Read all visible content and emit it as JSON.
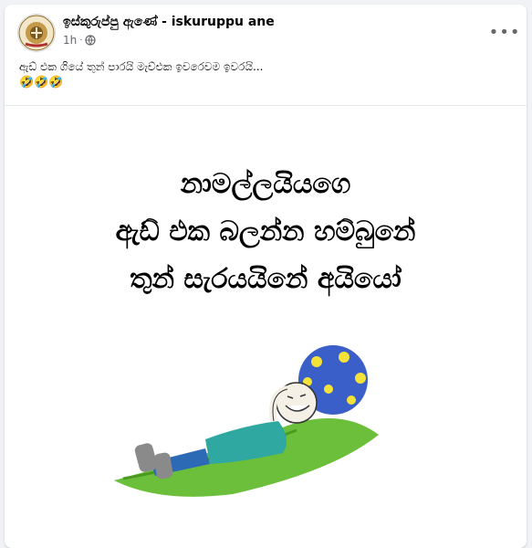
{
  "post": {
    "author": "ඉස්කුරුප්පු ඇණේ - iskuruppu ane",
    "time": "1h",
    "audience_icon": "globe-icon",
    "more_icon": "more-options-icon",
    "caption": "ඇඩ් එක ගියේ තුන් පාරයි මැච්එක ඉවරෙවම ඉවරයි...",
    "emojis": "🤣🤣🤣",
    "avatar_text": "ඉස්කු ඇණේ"
  },
  "image": {
    "line1": "නාමල්ලයියගෙ",
    "line2": "ඇඩ් එක බලන්න හම්බුනේ",
    "line3": "තුන් සැරයයිනේ අයියෝ"
  },
  "colors": {
    "page_bg": "#f0f2f5",
    "card_bg": "#ffffff",
    "name_text": "#050505",
    "meta_text": "#65676b"
  }
}
